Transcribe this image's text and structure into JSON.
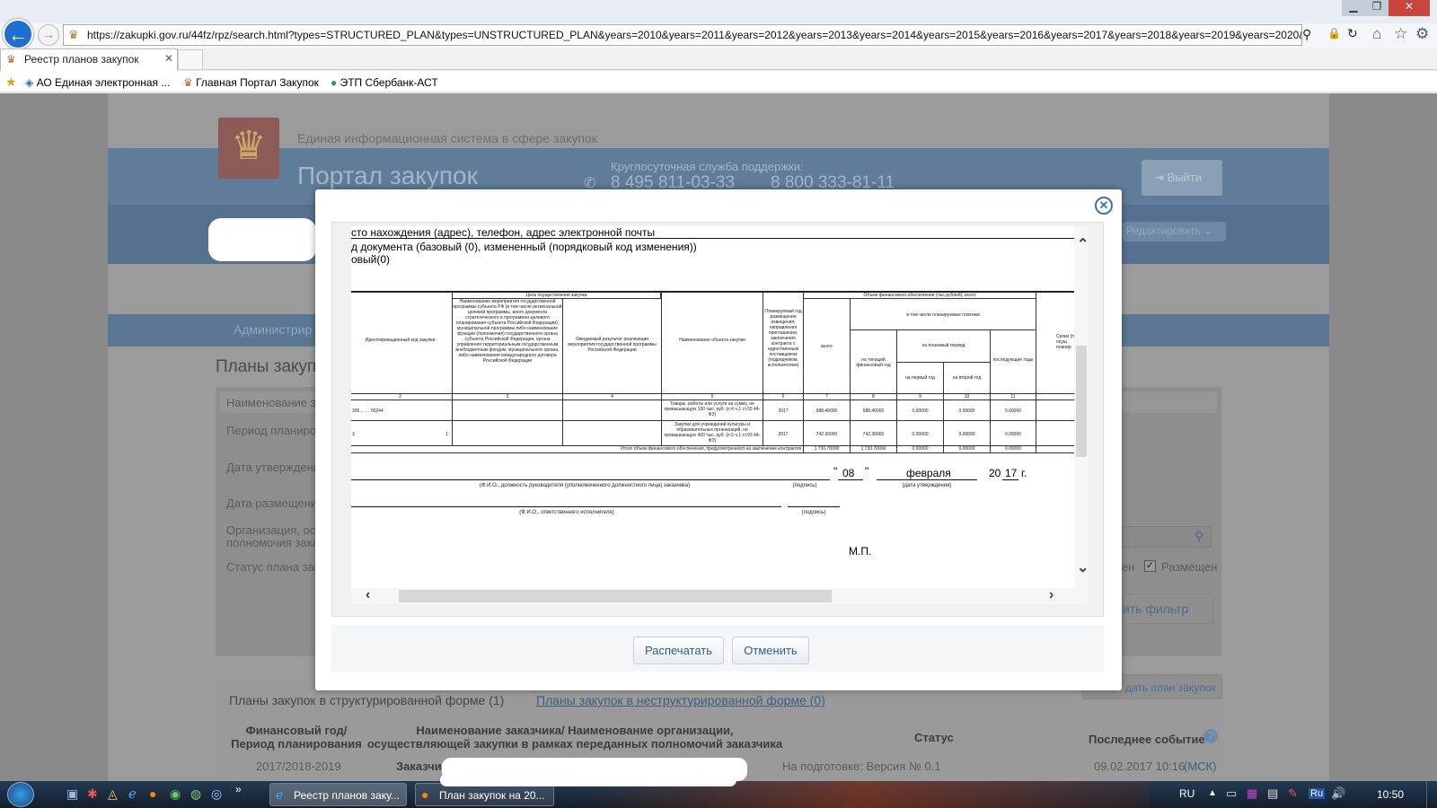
{
  "browser": {
    "address_url": "https://zakupki.gov.ru/44fz/rpz/search.html?types=STRUCTURED_PLAN&types=UNSTRUCTURED_PLAN&years=2010&years=2011&years=2012&years=2013&years=2014&years=2015&years=2016&years=2017&years=2018&years=2019&years=2020&years",
    "active_tab_title": "Реестр планов закупок",
    "favorites": [
      "АО Единая электронная ...",
      "Главная Портал Закупок",
      "ЭТП Сбербанк-АСТ"
    ]
  },
  "site": {
    "eis_title": "Единая информационная система в сфере закупок",
    "portal_title": "Портал закупок",
    "support_label": "Круглосуточная служба поддержки:",
    "phone1": "8 495 811-03-33",
    "phone2": "8 800 333-81-11",
    "logout_label": "Выйти",
    "edit_label": "Редактировать",
    "admin_label": "Администрир",
    "section_title": "Планы закуп",
    "filters": [
      "Наименование за",
      "Период планиров",
      "Дата утверждени",
      "Дата размещения",
      "Организация, осу",
      "полномочия заказ",
      "Статус плана заку"
    ],
    "status_placed_label": "Размещен",
    "status_partial_label": "ен",
    "apply_filter_label": "ить фильтр",
    "create_plan_label": "дать план закупок",
    "tab_structured": "Планы закупок в структурированной форме (1)",
    "tab_unstructured": "Планы закупок в неструктурированной форме (0)",
    "col_year": "Финансовый год/\nПериод планирования",
    "col_customer": "Наименование заказчика/ Наименование организации,\nосуществляющей закупки в рамках переданных полномочий заказчика",
    "col_status": "Статус",
    "col_event": "Последнее событие",
    "row_year": "2017/2018-2019",
    "row_customer": "Заказчик",
    "row_status": "На подготовке: Версия № 0.1",
    "row_event_date": "09.02.2017 10:16",
    "row_event_tz": "(МСК)"
  },
  "modal": {
    "doc_line1": "сто нахождения (адрес), телефон, адрес электронной почты",
    "doc_line2": "д документа (базовый (0), измененный (порядковый код изменения))",
    "doc_line3": "овый(0)",
    "table": {
      "h_goal": "Цель осуществления закупки",
      "h_finance": "Объем финансового обеспечения (тыс.рублей), всего",
      "h_id": "Идентификационный код закупки",
      "h_program": "Наименование мероприятия государственной программы субъекта РФ (в том числе региональной целевой программы, иного документа стратегического и программно-целевого планирования субъекта Российской Федерации), муниципальной программы либо наименование функции (полномочия) государственного органа субъекта Российской Федерации, органа управления территориальным государственным внебюджетным фондом, муниципального органа, либо наименование международного договора Российской Федерации",
      "h_result": "Ожидаемый результат реализации мероприятия государственной программы Российской Федерации",
      "h_object": "Наименование объекта закупки",
      "h_year": "Планируемый год размещения извещения, направления приглашения, заключения контракта с единственным поставщиком (подрядчиком, исполнителем)",
      "h_total": "всего",
      "h_incl": "в том числе планируемые платежи",
      "h_current": "на текущий финансовый год",
      "h_plan": "на плановый период",
      "h_first": "на первый год",
      "h_second": "на второй год",
      "h_next": "последующие годы",
      "h_terms": "Сроки (п осущ планир",
      "nums": [
        "2",
        "3",
        "4",
        "5",
        "6",
        "7",
        "8",
        "9",
        "10",
        "11"
      ],
      "row1_id": "305...    ....     00244",
      "row1_object": "Товары, работы или услуги на сумму, не превышающую 100 тыс. руб. (п.4 ч.1 ст.93 44-ФЗ)",
      "row1_year": "2017",
      "row1_total": "988.40000",
      "row1_current": "988.40000",
      "row1_first": "0.00000",
      "row1_second": "0.00000",
      "row1_next": "0.00000",
      "row2_id": "3",
      "row2_id_end": "1",
      "row2_object": "Закупки для учреждений культуры и образовательных организаций, не превышающую 400 тыс. руб. (п.5 ч.1 ст.93 44-ФЗ)",
      "row2_year": "2017",
      "row2_total": "742.30000",
      "row2_current": "742.30000",
      "row2_first": "0.00000",
      "row2_second": "0.00000",
      "row2_next": "0.00000",
      "total_label": "Итого объем финансового обеспечения, предусмотренного на заключение контрактов",
      "total_total": "1 730.70000",
      "total_current": "1 730.70000",
      "total_first": "0.00000",
      "total_second": "0.00000",
      "total_next": "0.00000"
    },
    "sign": {
      "quote_open": "\"",
      "day": "08",
      "quote_close": "\"",
      "month": "февраля",
      "year_prefix": "20",
      "year_suffix": "17",
      "year_unit": "г.",
      "caption_head": "(Ф.И.О., должность руководителя (уполномоченного должностного лица) заказчика)",
      "caption_sign": "(подпись)",
      "caption_date": "(дата утверждения)",
      "caption_exec": "(Ф.И.О., ответственного исполнителя)",
      "caption_sign2": "(подпись)",
      "stamp": "М.П."
    },
    "print_label": "Распечатать",
    "cancel_label": "Отменить"
  },
  "taskbar": {
    "task1": "Реестр планов заку...",
    "task2": "План закупок на 20...",
    "lang": "RU",
    "lang2": "Ru",
    "time": "10:50"
  }
}
